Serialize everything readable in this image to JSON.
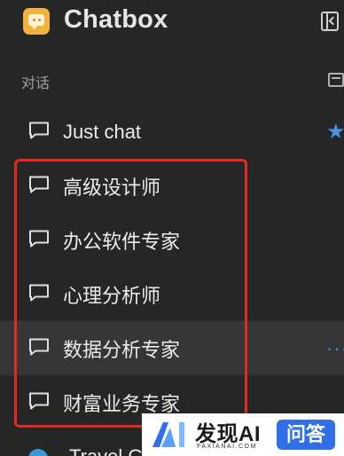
{
  "app": {
    "title": "Chatbox"
  },
  "sidebar": {
    "section_label": "对话",
    "conversations": [
      {
        "label": "Just chat",
        "starred": true
      },
      {
        "label": "高级设计师"
      },
      {
        "label": "办公软件专家"
      },
      {
        "label": "心理分析师"
      },
      {
        "label": "数据分析专家",
        "hovered": true,
        "more_label": "···"
      },
      {
        "label": "财富业务专家"
      }
    ],
    "partial_item": {
      "label": "Travel Guide (Example)"
    }
  },
  "icons": {
    "app": "chatbox-app-icon",
    "collapse": "sidebar-collapse-icon",
    "archive": "archive-icon",
    "conversation": "chat-bubble-icon",
    "star": "star-icon",
    "more": "more-dots-icon"
  },
  "colors": {
    "background": "#262626",
    "accent": "#4a90e2",
    "highlight_border": "#e22a1f"
  },
  "watermark": {
    "title": "发现AI",
    "subtitle": "FAXIANAI.COM",
    "badge": "问答"
  }
}
